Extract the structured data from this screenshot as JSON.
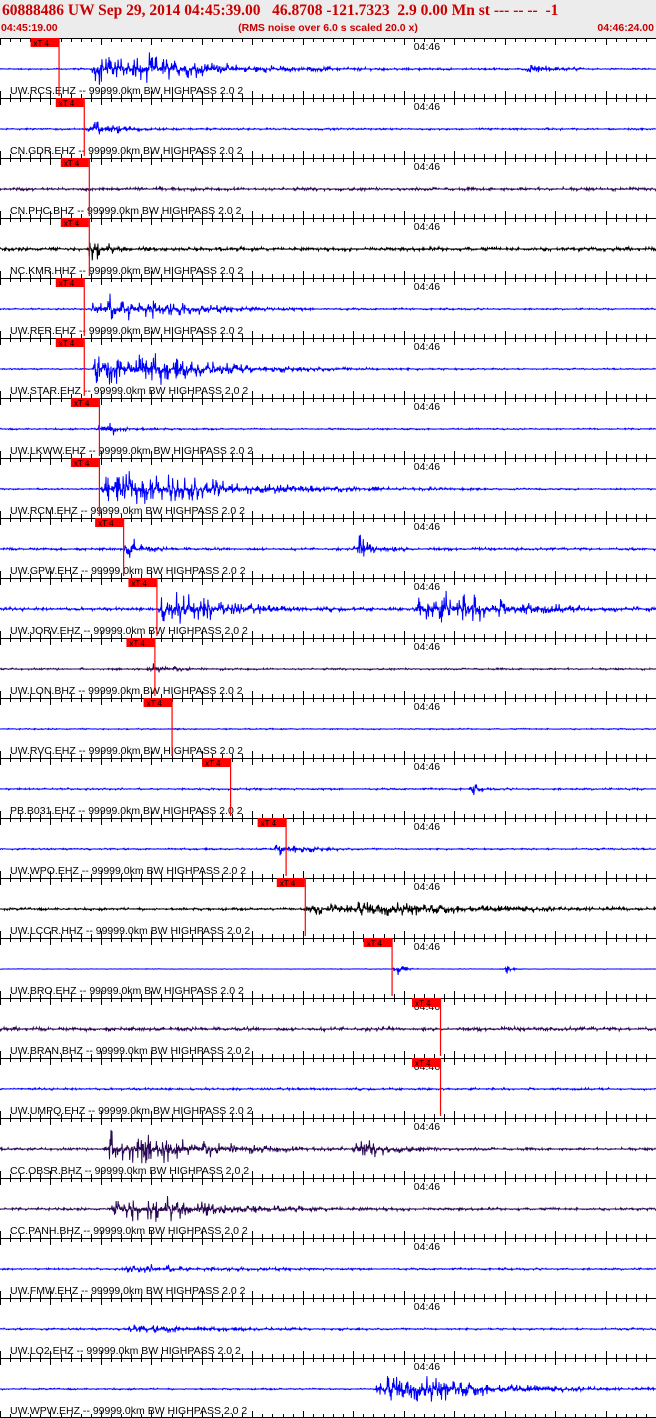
{
  "header": {
    "title": "60888486 UW Sep 29, 2014 04:45:39.00   46.8708 -121.7323  2.9 0.00 Mn st --- -- --  -1",
    "start_time": "04:45:19.00",
    "end_time": "04:46:24.00",
    "noise_note": "(RMS noise over 6.0 s scaled 20.0 x)"
  },
  "colors": {
    "blue": "#0000ff",
    "black": "#000000",
    "purple": "#2b0a55",
    "pick": "#ff0000",
    "header_text": "#cc0000"
  },
  "chart_data": {
    "type": "line",
    "title": "60888486 UW Sep 29, 2014 04:45:39.00   46.8708 -121.7323  2.9 0.00 Mn st --- -- --  -1",
    "x_range": [
      "04:45:19.00",
      "04:46:24.00"
    ],
    "minute_label": "04:46",
    "pick_label": "xT 4",
    "traces": [
      {
        "label": "UW.RCS.EHZ -- 99999.0km BW  HIGHPASS  2.0  2",
        "color": "blue",
        "pick_s": 5.8,
        "events": [
          {
            "t": 9,
            "dur": 16,
            "amp": 0.9
          },
          {
            "t": 52,
            "dur": 3,
            "amp": 0.35
          }
        ],
        "base": 0.05
      },
      {
        "label": "CN.GDR.EHZ -- 99999.0km BW  HIGHPASS  2.0  2",
        "color": "blue",
        "pick_s": 8.3,
        "events": [
          {
            "t": 8.5,
            "dur": 4,
            "amp": 0.55
          }
        ],
        "base": 0.06
      },
      {
        "label": "CN.PHC.BHZ -- 99999.0km BW  HIGHPASS  2.0  2",
        "color": "purple",
        "pick_s": 8.8,
        "events": [],
        "base": 0.1
      },
      {
        "label": "NC.KMR.HHZ -- 99999.0km BW  HIGHPASS  2.0  2",
        "color": "black",
        "pick_s": 8.8,
        "events": [
          {
            "t": 8.5,
            "dur": 2,
            "amp": 0.8
          }
        ],
        "base": 0.12
      },
      {
        "label": "UW.RER.EHZ -- 99999.0km BW  HIGHPASS  2.0  2",
        "color": "blue",
        "pick_s": 8.3,
        "events": [
          {
            "t": 9,
            "dur": 12,
            "amp": 0.85
          }
        ],
        "base": 0.05
      },
      {
        "label": "UW.STAR.EHZ -- 99999.0km BW  HIGHPASS  2.0  2",
        "color": "blue",
        "pick_s": 8.3,
        "events": [
          {
            "t": 9,
            "dur": 16,
            "amp": 1.0
          }
        ],
        "base": 0.04
      },
      {
        "label": "UW.LKWW.EHZ -- 99999.0km BW  HIGHPASS  2.0  2",
        "color": "blue",
        "pick_s": 9.8,
        "events": [
          {
            "t": 9.5,
            "dur": 3,
            "amp": 0.45
          }
        ],
        "base": 0.05
      },
      {
        "label": "UW.RCM.EHZ -- 99999.0km BW  HIGHPASS  2.0  2",
        "color": "blue",
        "pick_s": 9.8,
        "events": [
          {
            "t": 10,
            "dur": 18,
            "amp": 1.0
          }
        ],
        "base": 0.05
      },
      {
        "label": "UW.GPW.EHZ -- 99999.0km BW  HIGHPASS  2.0  2",
        "color": "blue",
        "pick_s": 12.2,
        "events": [
          {
            "t": 12.2,
            "dur": 2,
            "amp": 0.75
          },
          {
            "t": 35,
            "dur": 3,
            "amp": 0.8
          }
        ],
        "base": 0.08
      },
      {
        "label": "UW.JORV.EHZ -- 99999.0km BW  HIGHPASS  2.0  2",
        "color": "blue",
        "pick_s": 15.5,
        "events": [
          {
            "t": 15.5,
            "dur": 9,
            "amp": 1.0
          },
          {
            "t": 41,
            "dur": 13,
            "amp": 1.0
          }
        ],
        "base": 0.1
      },
      {
        "label": "UW.LON.BHZ -- 99999.0km BW  HIGHPASS  2.0  2",
        "color": "purple",
        "pick_s": 15.3,
        "events": [
          {
            "t": 14.5,
            "dur": 3,
            "amp": 0.35
          }
        ],
        "base": 0.06
      },
      {
        "label": "UW.RVC.EHZ -- 99999.0km BW  HIGHPASS  2.0  2",
        "color": "blue",
        "pick_s": 17,
        "events": [],
        "base": 0.04
      },
      {
        "label": "PB.B031.EHZ -- 99999.0km BW  HIGHPASS  2.0  2",
        "color": "blue",
        "pick_s": 22.8,
        "events": [
          {
            "t": 46.5,
            "dur": 0.5,
            "amp": 0.55
          }
        ],
        "base": 0.06
      },
      {
        "label": "UW.WPO.EHZ -- 99999.0km BW  HIGHPASS  2.0  2",
        "color": "blue",
        "pick_s": 28.3,
        "events": [
          {
            "t": 27,
            "dur": 4,
            "amp": 0.45
          }
        ],
        "base": 0.05
      },
      {
        "label": "UW.LCCR.HHZ -- 99999.0km BW  HIGHPASS  2.0  2",
        "color": "black",
        "pick_s": 30.2,
        "events": [
          {
            "t": 30,
            "dur": 24,
            "amp": 0.4
          }
        ],
        "base": 0.08
      },
      {
        "label": "UW.BRO.EHZ -- 99999.0km BW  HIGHPASS  2.0  2",
        "color": "blue",
        "pick_s": 38.8,
        "events": [
          {
            "t": 38.8,
            "dur": 0.8,
            "amp": 0.65
          },
          {
            "t": 49.8,
            "dur": 0.5,
            "amp": 0.45
          }
        ],
        "base": 0.02
      },
      {
        "label": "UW.BRAN.BHZ -- 99999.0km BW  HIGHPASS  2.0  2",
        "color": "purple",
        "pick_s": 43.6,
        "events": [],
        "base": 0.12
      },
      {
        "label": "UW.UMPQ.EHZ -- 99999.0km BW  HIGHPASS  2.0  2",
        "color": "blue",
        "pick_s": 43.6,
        "events": [],
        "base": 0.07
      },
      {
        "label": "CC.OBSR.BHZ -- 99999.0km BW  HIGHPASS  2.0  2",
        "color": "purple",
        "pick_s": null,
        "events": [
          {
            "t": 10,
            "dur": 14,
            "amp": 1.0
          },
          {
            "t": 35,
            "dur": 5,
            "amp": 0.45
          }
        ],
        "base": 0.08
      },
      {
        "label": "CC.PANH.BHZ -- 99999.0km BW  HIGHPASS  2.0  2",
        "color": "purple",
        "pick_s": null,
        "events": [
          {
            "t": 11,
            "dur": 14,
            "amp": 0.75
          }
        ],
        "base": 0.08
      },
      {
        "label": "UW.FMW.EHZ -- 99999.0km BW  HIGHPASS  2.0  2",
        "color": "blue",
        "pick_s": null,
        "events": [
          {
            "t": 12,
            "dur": 12,
            "amp": 0.2
          }
        ],
        "base": 0.06
      },
      {
        "label": "UW.LO2.EHZ -- 99999.0km BW  HIGHPASS  2.0  2",
        "color": "blue",
        "pick_s": null,
        "events": [
          {
            "t": 12,
            "dur": 12,
            "amp": 0.2
          }
        ],
        "base": 0.06
      },
      {
        "label": "UW.WPW.EHZ -- 99999.0km BW  HIGHPASS  2.0  2",
        "color": "blue",
        "pick_s": null,
        "events": [
          {
            "t": 37,
            "dur": 16,
            "amp": 0.8
          }
        ],
        "base": 0.05
      }
    ]
  }
}
